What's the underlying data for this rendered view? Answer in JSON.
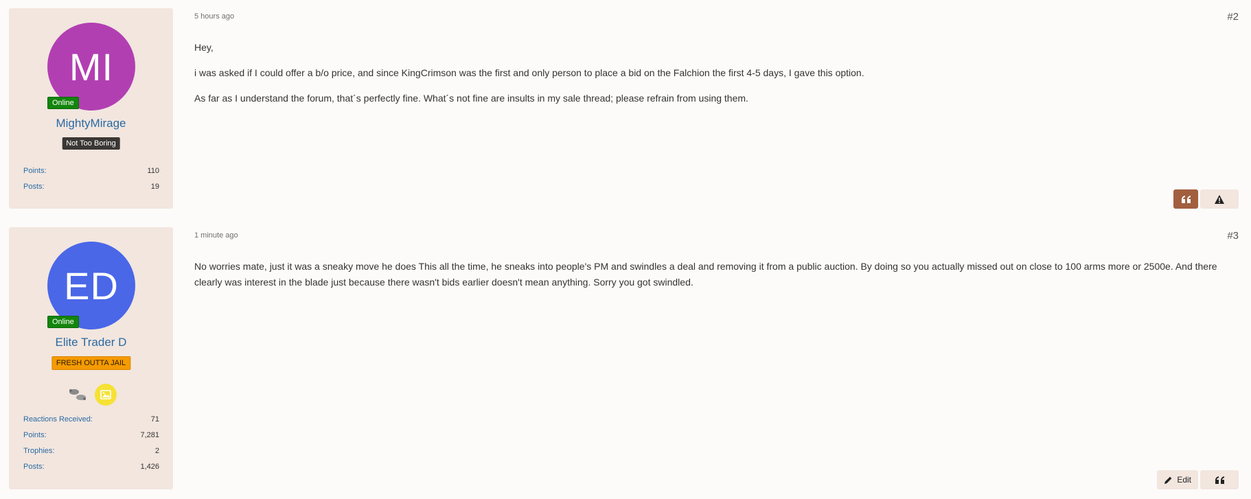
{
  "posts": [
    {
      "user": {
        "initials": "MI",
        "avatar_color": "#b23fb2",
        "online_label": "Online",
        "name": "MightyMirage",
        "banner": "Not Too Boring",
        "stats": [
          {
            "label": "Points:",
            "value": "110"
          },
          {
            "label": "Posts:",
            "value": "19"
          }
        ]
      },
      "time": "5 hours ago",
      "number": "#2",
      "paragraphs": [
        "Hey,",
        "i was asked if I could offer a b/o price, and since KingCrimson was the first and only person to place a bid on the Falchion the first 4-5 days, I gave this option.",
        "As far as I understand the forum, that´s perfectly fine. What´s not fine are insults in my sale thread; please refrain from using them."
      ],
      "actions": {
        "quote_icon": "quote-icon",
        "report_icon": "warning-icon"
      }
    },
    {
      "user": {
        "initials": "ED",
        "avatar_color": "#4a67e8",
        "online_label": "Online",
        "name": "Elite Trader D",
        "banner": "FRESH OUTTA JAIL",
        "stats": [
          {
            "label": "Reactions Received:",
            "value": "71"
          },
          {
            "label": "Points:",
            "value": "7,281"
          },
          {
            "label": "Trophies:",
            "value": "2"
          },
          {
            "label": "Posts:",
            "value": "1,426"
          }
        ]
      },
      "time": "1 minute ago",
      "number": "#3",
      "paragraphs": [
        "No worries mate, just it was a sneaky move he does This all the time, he sneaks into people's PM and swindles a deal and removing it from a public auction. By doing so you actually missed out on close to 100 arms more or 2500e. And there clearly was interest in the blade just because there wasn't bids earlier doesn't mean anything. Sorry you got swindled."
      ],
      "actions": {
        "edit_label": "Edit",
        "quote_icon": "quote-icon"
      }
    }
  ],
  "colors": {
    "accent_brown": "#a25f3f",
    "online_green": "#13850c",
    "link_blue": "#2b6aa2",
    "panel_beige": "#f2e6df"
  }
}
